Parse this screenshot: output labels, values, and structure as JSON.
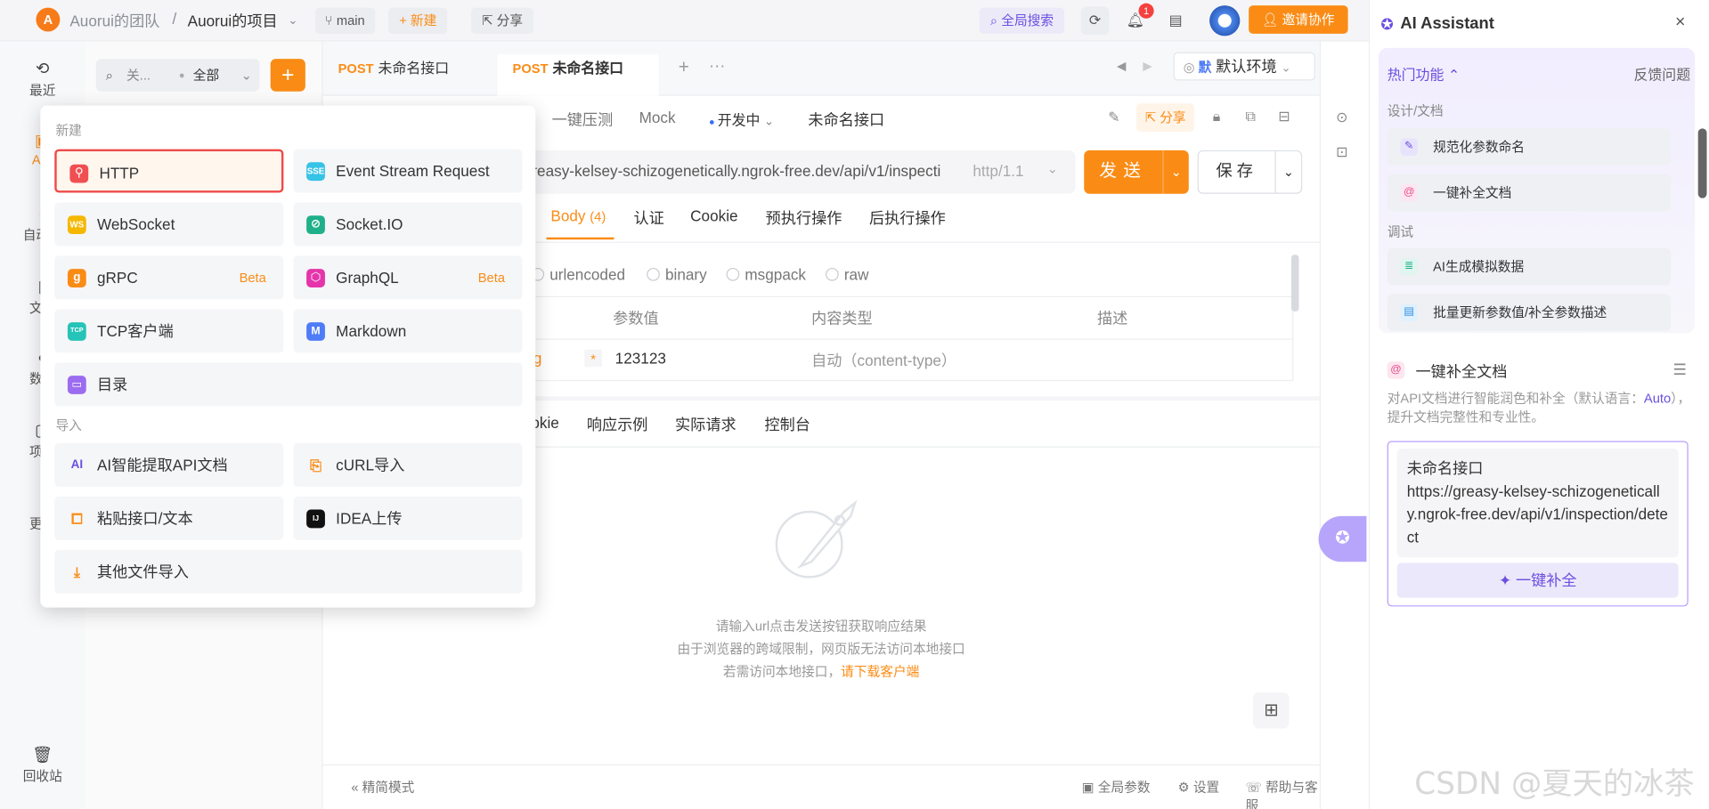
{
  "topbar": {
    "team": "Auorui的团队",
    "separator": "/",
    "project": "Auorui的项目",
    "branch": "main",
    "new_label": "新建",
    "share_label": "分享",
    "global_search": "全局搜索",
    "notification_count": "1",
    "invite_label": "邀请协作"
  },
  "left_nav": {
    "items": [
      {
        "label": "最近",
        "icon": "history-icon"
      },
      {
        "label": "API",
        "icon": "api-icon"
      },
      {
        "label": "自动化",
        "icon": "automation-icon"
      },
      {
        "label": "文档",
        "icon": "doc-icon"
      },
      {
        "label": "数据",
        "icon": "data-icon"
      },
      {
        "label": "项目",
        "icon": "project-icon"
      },
      {
        "label": "更多",
        "icon": "more-icon"
      }
    ],
    "trash_label": "回收站"
  },
  "side_panel": {
    "search_placeholder": "关...",
    "filter_value": "全部"
  },
  "tabs": [
    {
      "method": "POST",
      "name": "未命名接口",
      "active": false
    },
    {
      "method": "POST",
      "name": "未命名接口",
      "active": true
    }
  ],
  "environment": {
    "badge": "默",
    "label": "默认环境"
  },
  "sub_toolbar": {
    "stress_test": "一键压测",
    "mock": "Mock",
    "status": "开发中",
    "api_name": "未命名接口",
    "share": "分享"
  },
  "request": {
    "url": "greasy-kelsey-schizogenetically.ngrok-free.dev/api/v1/inspecti",
    "protocol": "http/1.1",
    "send": "发送",
    "save": "保存"
  },
  "param_tabs": {
    "body": "Body",
    "body_count": "(4)",
    "auth": "认证",
    "cookie": "Cookie",
    "pre": "预执行操作",
    "post": "后执行操作"
  },
  "body_types": [
    "urlencoded",
    "binary",
    "msgpack",
    "raw"
  ],
  "param_table": {
    "headers": [
      "参数值",
      "内容类型",
      "描述"
    ],
    "row": {
      "name_tail": "g",
      "required": "*",
      "value": "123123",
      "content_type": "自动（content-type）"
    }
  },
  "response_tabs": [
    "okie",
    "响应示例",
    "实际请求",
    "控制台"
  ],
  "empty_state": {
    "line1": "请输入url点击发送按钮获取响应结果",
    "line2": "由于浏览器的跨域限制，网页版无法访问本地接口",
    "line3_prefix": "若需访问本地接口，",
    "line3_link": "请下载客户端"
  },
  "footer": {
    "compact": "精简模式",
    "global_params": "全局参数",
    "settings": "设置",
    "help": "帮助与客服"
  },
  "ai": {
    "title": "AI Assistant",
    "hot_label": "热门功能",
    "feedback": "反馈问题",
    "section_design": "设计/文档",
    "item_naming": "规范化参数命名",
    "item_complete": "一键补全文档",
    "section_debug": "调试",
    "item_mock": "AI生成模拟数据",
    "item_batch": "批量更新参数值/补全参数描述",
    "complete_title": "一键补全文档",
    "complete_desc_prefix": "对API文档进行智能润色和补全（默认语言：",
    "complete_desc_lang": "Auto",
    "complete_desc_suffix": "），提升文档完整性和专业性。",
    "card_name": "未命名接口",
    "card_url": "https://greasy-kelsey-schizogenetically.ngrok-free.dev/api/v1/inspection/detect",
    "fill_button": "一键补全"
  },
  "dropdown": {
    "section_new": "新建",
    "new_items": [
      {
        "label": "HTTP",
        "icon": "http-icon",
        "badge_text": "",
        "color": "#f04f52"
      },
      {
        "label": "Event Stream Request",
        "icon": "sse-icon",
        "badge_text": "SSE",
        "color": "#36c3e6"
      },
      {
        "label": "WebSocket",
        "icon": "websocket-icon",
        "badge_text": "WS",
        "color": "#f5b800"
      },
      {
        "label": "Socket.IO",
        "icon": "socketio-icon",
        "badge_text": "",
        "color": "#1fb08a"
      },
      {
        "label": "gRPC",
        "icon": "grpc-icon",
        "badge_text": "g",
        "color": "#fa8c16",
        "beta": "Beta"
      },
      {
        "label": "GraphQL",
        "icon": "graphql-icon",
        "badge_text": "",
        "color": "#e535ab",
        "beta": "Beta"
      },
      {
        "label": "TCP客户端",
        "icon": "tcp-icon",
        "badge_text": "TCP",
        "color": "#26c3b8"
      },
      {
        "label": "Markdown",
        "icon": "markdown-icon",
        "badge_text": "M",
        "color": "#4f7cf7"
      },
      {
        "label": "目录",
        "icon": "folder-icon",
        "badge_text": "",
        "color": "#9b6cf0"
      }
    ],
    "section_import": "导入",
    "import_items": [
      {
        "label": "AI智能提取API文档",
        "icon": "ai-extract-icon",
        "badge_text": "AI"
      },
      {
        "label": "cURL导入",
        "icon": "curl-icon",
        "badge_text": ""
      },
      {
        "label": "粘贴接口/文本",
        "icon": "paste-icon",
        "badge_text": ""
      },
      {
        "label": "IDEA上传",
        "icon": "idea-icon",
        "badge_text": "IJ"
      },
      {
        "label": "其他文件导入",
        "icon": "download-icon",
        "badge_text": ""
      }
    ]
  },
  "watermark": "CSDN @夏天的冰茶"
}
